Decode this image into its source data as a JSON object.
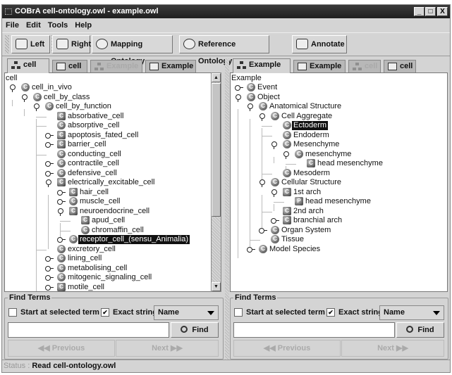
{
  "window": {
    "title": "COBrA  cell-ontology.owl - example.owl",
    "controls": [
      "_",
      "□",
      "X"
    ]
  },
  "menu": [
    "File",
    "Edit",
    "Tools",
    "Help"
  ],
  "toolbar": {
    "left": "Left",
    "right": "Right",
    "mapping": "Mapping Ontology",
    "reference": "Reference Ontology",
    "annotate": "Annotate"
  },
  "left": {
    "tabs": [
      {
        "label": "cell",
        "icon": "tree",
        "active": true
      },
      {
        "label": "cell",
        "icon": "list"
      },
      {
        "label": "Example",
        "icon": "tree",
        "disabled": true
      },
      {
        "label": "Example",
        "icon": "list"
      }
    ],
    "root": "cell",
    "nodes": [
      {
        "label": "cell_in_vivo",
        "level": 0,
        "state": "open",
        "icon": "c"
      },
      {
        "label": "cell_by_class",
        "level": 1,
        "state": "open",
        "icon": "c"
      },
      {
        "label": "cell_by_function",
        "level": 2,
        "state": "open",
        "icon": "c"
      },
      {
        "label": "absorbative_cell",
        "level": 3,
        "state": "leaf",
        "icon": "cs"
      },
      {
        "label": "absorptive_cell",
        "level": 3,
        "state": "leaf",
        "icon": "c"
      },
      {
        "label": "apoptosis_fated_cell",
        "level": 3,
        "state": "closed",
        "icon": "cs"
      },
      {
        "label": "barrier_cell",
        "level": 3,
        "state": "closed",
        "icon": "cs"
      },
      {
        "label": "conducting_cell",
        "level": 3,
        "state": "leaf",
        "icon": "c"
      },
      {
        "label": "contractile_cell",
        "level": 3,
        "state": "closed",
        "icon": "c"
      },
      {
        "label": "defensive_cell",
        "level": 3,
        "state": "closed",
        "icon": "c"
      },
      {
        "label": "electrically_excitable_cell",
        "level": 3,
        "state": "open",
        "icon": "cs"
      },
      {
        "label": "hair_cell",
        "level": 4,
        "state": "closed",
        "icon": "cs"
      },
      {
        "label": "muscle_cell",
        "level": 4,
        "state": "closed",
        "icon": "c"
      },
      {
        "label": "neuroendocrine_cell",
        "level": 4,
        "state": "open",
        "icon": "cs"
      },
      {
        "label": "apud_cell",
        "level": 5,
        "state": "leaf",
        "icon": "cs"
      },
      {
        "label": "chromaffin_cell",
        "level": 5,
        "state": "leaf",
        "icon": "c"
      },
      {
        "label": "receptor_cell_(sensu_Animalia)",
        "level": 4,
        "state": "closed",
        "icon": "c",
        "selected": true
      },
      {
        "label": "excretory_cell",
        "level": 3,
        "state": "leaf",
        "icon": "c"
      },
      {
        "label": "lining_cell",
        "level": 3,
        "state": "closed",
        "icon": "c"
      },
      {
        "label": "metabolising_cell",
        "level": 3,
        "state": "closed",
        "icon": "c"
      },
      {
        "label": "mitogenic_signaling_cell",
        "level": 3,
        "state": "closed",
        "icon": "c"
      },
      {
        "label": "motile_cell",
        "level": 3,
        "state": "closed",
        "icon": "cs"
      }
    ],
    "find": {
      "legend": "Find Terms",
      "start_at_selected": "Start at selected term",
      "start_checked": false,
      "exact": "Exact string",
      "exact_checked": true,
      "field": "Name",
      "input": "",
      "find": "Find",
      "previous": "Previous",
      "next": "Next"
    }
  },
  "right": {
    "tabs": [
      {
        "label": "Example",
        "icon": "tree",
        "active": true
      },
      {
        "label": "Example",
        "icon": "list"
      },
      {
        "label": "cell",
        "icon": "tree",
        "disabled": true
      },
      {
        "label": "cell",
        "icon": "list"
      }
    ],
    "root": "Example",
    "nodes": [
      {
        "label": "Event",
        "level": 0,
        "state": "closed",
        "icon": "c"
      },
      {
        "label": "Object",
        "level": 0,
        "state": "open",
        "icon": "c"
      },
      {
        "label": "Anatomical Structure",
        "level": 1,
        "state": "open",
        "icon": "c"
      },
      {
        "label": "Cell Aggregate",
        "level": 2,
        "state": "open",
        "icon": "c"
      },
      {
        "label": "Ectoderm",
        "level": 3,
        "state": "leaf",
        "icon": "c",
        "selected": true
      },
      {
        "label": "Endoderm",
        "level": 3,
        "state": "leaf",
        "icon": "c"
      },
      {
        "label": "Mesenchyme",
        "level": 3,
        "state": "open",
        "icon": "c"
      },
      {
        "label": "mesenchyme",
        "level": 4,
        "state": "open",
        "icon": "c"
      },
      {
        "label": "head mesenchyme",
        "level": 5,
        "state": "leaf",
        "icon": "cs"
      },
      {
        "label": "Mesoderm",
        "level": 3,
        "state": "leaf",
        "icon": "c"
      },
      {
        "label": "Cellular Structure",
        "level": 2,
        "state": "open",
        "icon": "c"
      },
      {
        "label": "1st arch",
        "level": 3,
        "state": "open",
        "icon": "cs"
      },
      {
        "label": "head mesenchyme",
        "level": 4,
        "state": "leaf",
        "icon": "p"
      },
      {
        "label": "2nd arch",
        "level": 3,
        "state": "leaf",
        "icon": "cs"
      },
      {
        "label": "branchial arch",
        "level": 3,
        "state": "closed",
        "icon": "cs"
      },
      {
        "label": "Organ System",
        "level": 2,
        "state": "closed",
        "icon": "c"
      },
      {
        "label": "Tissue",
        "level": 2,
        "state": "leaf",
        "icon": "c"
      },
      {
        "label": "Model Species",
        "level": 1,
        "state": "closed",
        "icon": "c"
      }
    ],
    "find": {
      "legend": "Find Terms",
      "start_at_selected": "Start at selected term",
      "start_checked": false,
      "exact": "Exact string",
      "exact_checked": true,
      "field": "Name",
      "input": "",
      "find": "Find",
      "previous": "Previous",
      "next": "Next"
    }
  },
  "status": {
    "key": "Status : ",
    "text": "Read cell-ontology.owl"
  }
}
